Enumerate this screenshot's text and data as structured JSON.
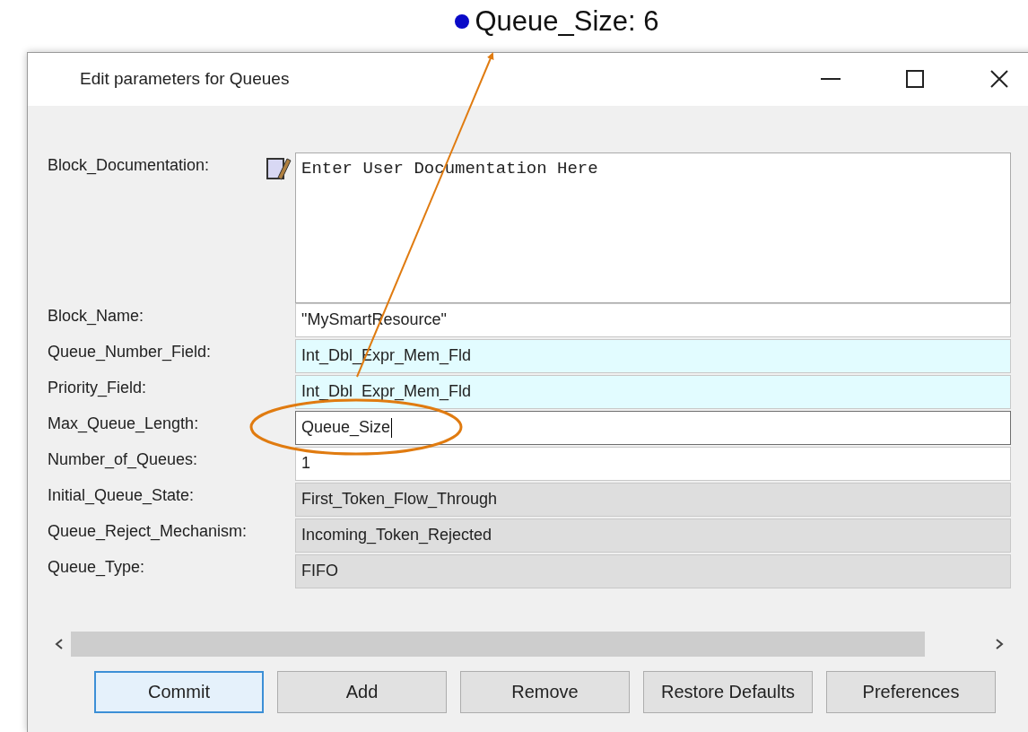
{
  "annotation": {
    "label": "Queue_Size: 6"
  },
  "window": {
    "title": "Edit parameters for Queues"
  },
  "documentation": {
    "label": "Block_Documentation:",
    "value": "Enter User Documentation Here"
  },
  "fields": [
    {
      "label": "Block_Name:",
      "value": "\"MySmartResource\"",
      "kind": "text",
      "focused": false
    },
    {
      "label": "Queue_Number_Field:",
      "value": "Int_Dbl_Expr_Mem_Fld",
      "kind": "member",
      "focused": false
    },
    {
      "label": "Priority_Field:",
      "value": "Int_Dbl_Expr_Mem_Fld",
      "kind": "member",
      "focused": false
    },
    {
      "label": "Max_Queue_Length:",
      "value": "Queue_Size",
      "kind": "text",
      "focused": true
    },
    {
      "label": "Number_of_Queues:",
      "value": "1",
      "kind": "text",
      "focused": false
    },
    {
      "label": "Initial_Queue_State:",
      "value": "First_Token_Flow_Through",
      "kind": "choice",
      "focused": false
    },
    {
      "label": "Queue_Reject_Mechanism:",
      "value": "Incoming_Token_Rejected",
      "kind": "choice",
      "focused": false
    },
    {
      "label": "Queue_Type:",
      "value": "FIFO",
      "kind": "choice",
      "focused": false
    }
  ],
  "buttons": [
    {
      "label": "Commit",
      "default": true
    },
    {
      "label": "Add",
      "default": false
    },
    {
      "label": "Remove",
      "default": false
    },
    {
      "label": "Restore Defaults",
      "default": false
    },
    {
      "label": "Preferences",
      "default": false
    }
  ]
}
